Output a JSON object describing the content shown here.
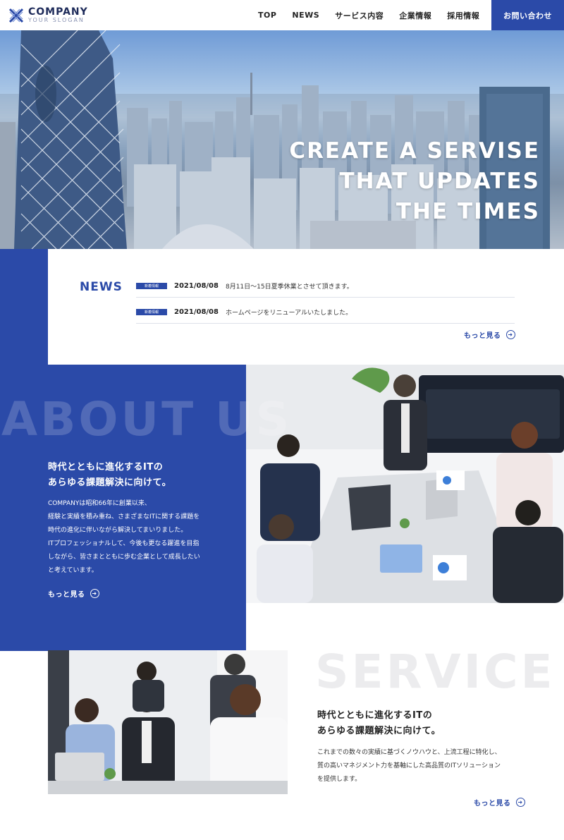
{
  "header": {
    "logo_name": "COMPANY",
    "logo_slogan": "YOUR SLOGAN",
    "nav": [
      "TOP",
      "NEWS",
      "サービス内容",
      "企業情報",
      "採用情報"
    ],
    "contact_label": "お問い合わせ"
  },
  "hero": {
    "lines": [
      "CREATE A SERVISE",
      "THAT UPDATES",
      "THE TIMES"
    ]
  },
  "news": {
    "title": "NEWS",
    "items": [
      {
        "tag": "新着情報",
        "date": "2021/08/08",
        "text": "8月11日〜15日夏季休業とさせて頂きます。"
      },
      {
        "tag": "新着情報",
        "date": "2021/08/08",
        "text": "ホームページをリニューアルいたしました。"
      }
    ],
    "more_label": "もっと見る"
  },
  "about": {
    "bg_text": "ABOUT US",
    "heading_lines": [
      "時代とともに進化するITの",
      "あらゆる課題解決に向けて。"
    ],
    "body_lines": [
      "COMPANYは昭和66年に創業以来、",
      "経験と実績を積み重ね、さまざまなITに関する課題を",
      "時代の進化に伴いながら解決してまいりました。",
      "ITプロフェッショナルして、今後も更なる躍進を目指",
      "しながら、皆さまとともに歩む企業として成長したい",
      "と考えています。"
    ],
    "more_label": "もっと見る"
  },
  "service": {
    "bg_text": "SERVICE",
    "heading_lines": [
      "時代とともに進化するITの",
      "あらゆる課題解決に向けて。"
    ],
    "body_lines": [
      "これまでの数々の実績に基づくノウハウと、上流工程に特化し、",
      "質の高いマネジメント力を基軸にした高品質のITソリューション",
      "を提供します。"
    ],
    "more_label": "もっと見る"
  },
  "colors": {
    "brand_blue": "#2b4aa8",
    "navy": "#1e2b5a"
  },
  "icons": {
    "logo": "crossed-x-logo-icon",
    "more": "circle-arrow-right-icon"
  }
}
